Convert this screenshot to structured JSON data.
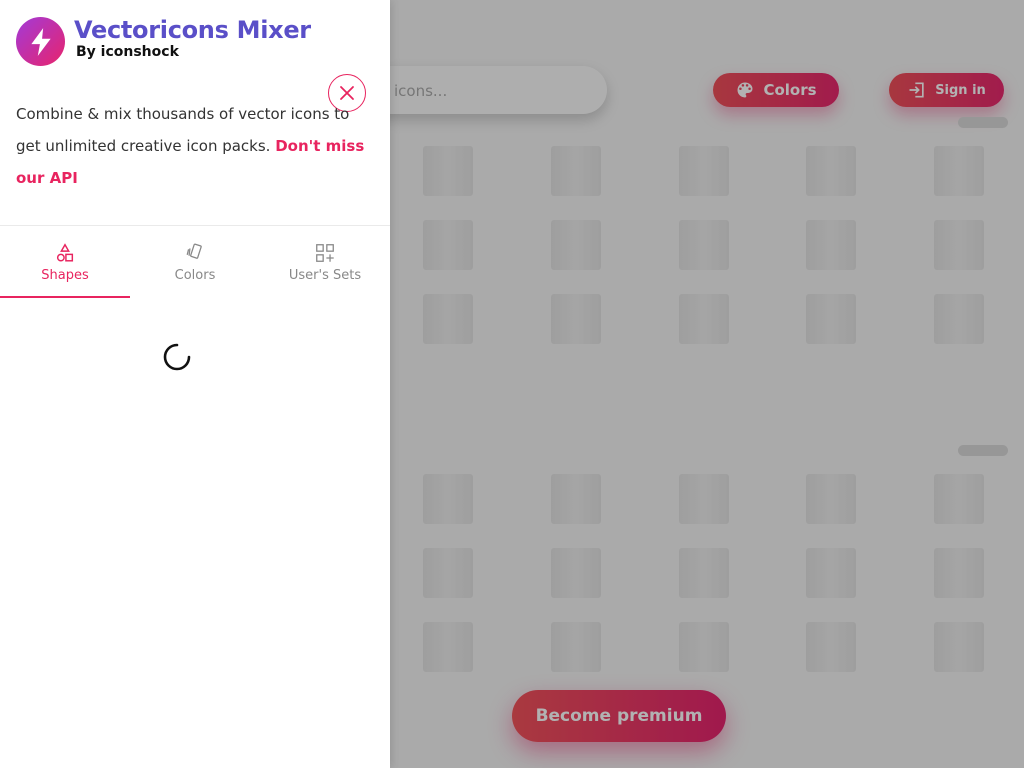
{
  "header": {
    "search_placeholder": "icons...",
    "colors_button": "Colors",
    "signin_button": "Sign in"
  },
  "premium_button": "Become premium",
  "panel": {
    "title": "Vectoricons Mixer",
    "subtitle": "By iconshock",
    "description": "Combine & mix thousands of vector icons to get unlimited creative icon packs.",
    "api_link": "Don't miss our API",
    "close_icon": "close-icon",
    "tabs": [
      {
        "label": "Shapes",
        "icon": "shapes-icon",
        "active": true
      },
      {
        "label": "Colors",
        "icon": "colors-cards-icon",
        "active": false
      },
      {
        "label": "User's Sets",
        "icon": "user-sets-icon",
        "active": false
      }
    ],
    "loading": true
  },
  "colors": {
    "accent": "#e8245f",
    "title": "#5a4fc8",
    "gradient_start": "#f0505a",
    "gradient_end": "#e8286e"
  }
}
